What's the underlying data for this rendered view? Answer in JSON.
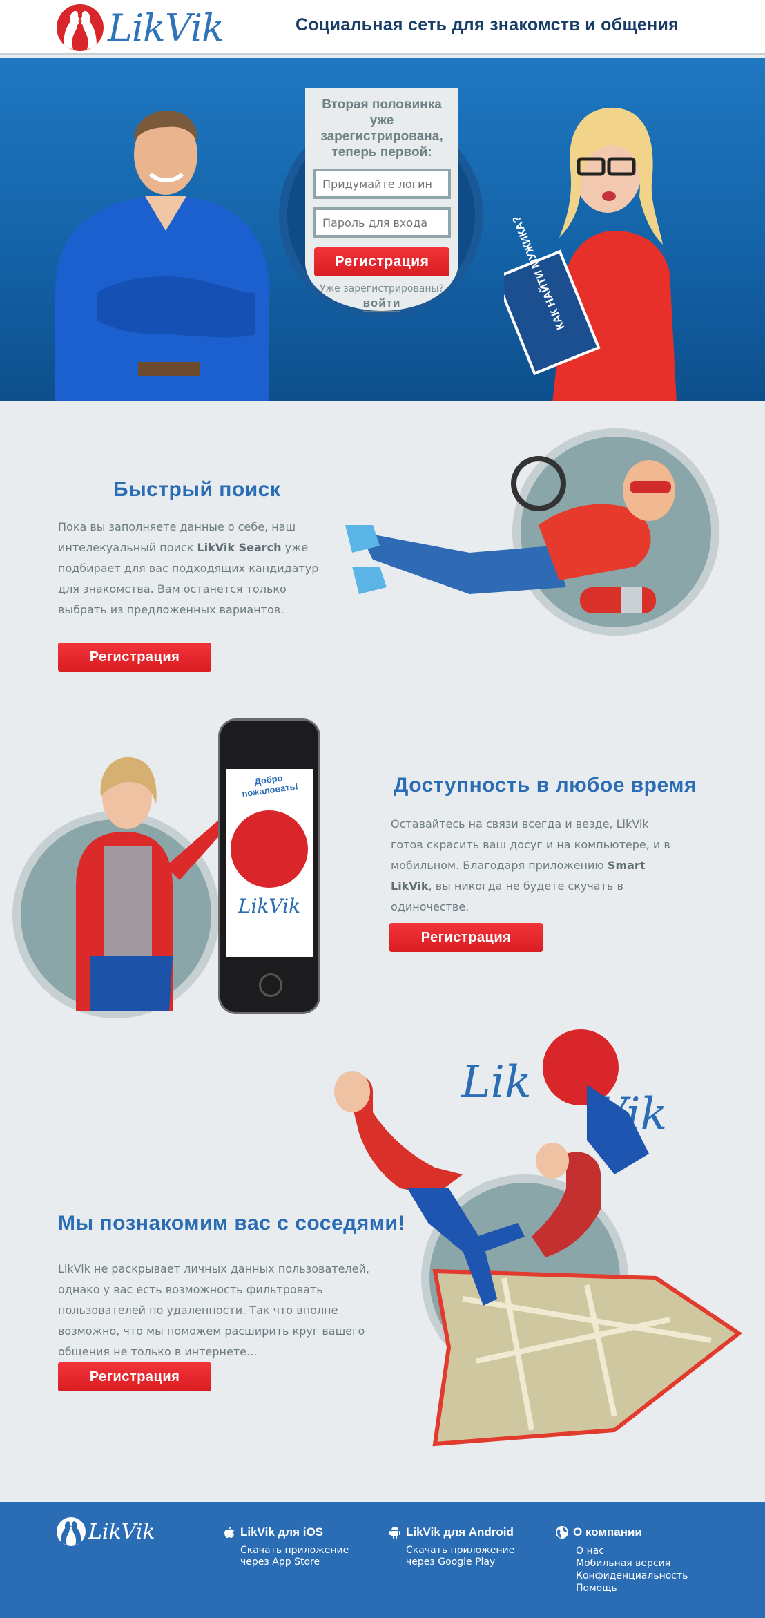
{
  "header": {
    "logo_text": "LikVik",
    "tagline": "Социальная сеть для знакомств и общения"
  },
  "hero": {
    "title": "Вторая половинка уже зарегистрирована, теперь первой:",
    "login_placeholder": "Придумайте логин",
    "password_placeholder": "Пароль для входа",
    "register_label": "Регистрация",
    "already_text": "Уже зарегистрированы?",
    "login_label": "войти",
    "book_text": "КАК НАЙТИ МУЖИКА?"
  },
  "sections": [
    {
      "title": "Быстрый поиск",
      "text_before": "Пока вы заполняете данные о себе, наш интелекуальный поиск ",
      "text_bold": "LikVik Search",
      "text_after": " уже подбирает для вас подходящих кандидатур для знакомства. Вам останется только выбрать из предложенных вариантов.",
      "button_label": "Регистрация"
    },
    {
      "title": "Доступность в любое время",
      "text_before": "Оставайтесь на связи всегда и везде, LikVik готов скрасить ваш досуг и на компьютере, и в мобильном. Благодаря приложению ",
      "text_bold": "Smart LikVik",
      "text_after": ", вы никогда не будете скучать в одиночестве.",
      "button_label": "Регистрация",
      "phone_text": "Добро пожаловать!",
      "phone_logo": "LikVik"
    },
    {
      "title": "Мы познакомим вас с соседями!",
      "text_before": "LikVik не раскрывает личных данных пользователей, однако у вас есть возможность фильтровать пользователей по удаленности. Так что вполне возможно, что мы поможем расширить круг вашего общения не только в интернете...",
      "text_bold": "",
      "text_after": "",
      "button_label": "Регистрация",
      "logo_left": "Lik",
      "logo_right": "Vik"
    }
  ],
  "footer": {
    "logo_text": "LikVik",
    "ios": {
      "title": "LikVik для iOS",
      "link": "Скачать приложение",
      "sub": "через App Store"
    },
    "android": {
      "title": "LikVik для Android",
      "link": "Скачать приложение",
      "sub": "через Google Play"
    },
    "about": {
      "title": "О компании",
      "items": [
        "О нас",
        "Мобильная версия",
        "Конфиденциальность",
        "Помощь"
      ]
    }
  },
  "colors": {
    "accent_blue": "#2a6db4",
    "header_text": "#173c66",
    "button_red": "#d81d23",
    "background": "#e8ecef"
  }
}
